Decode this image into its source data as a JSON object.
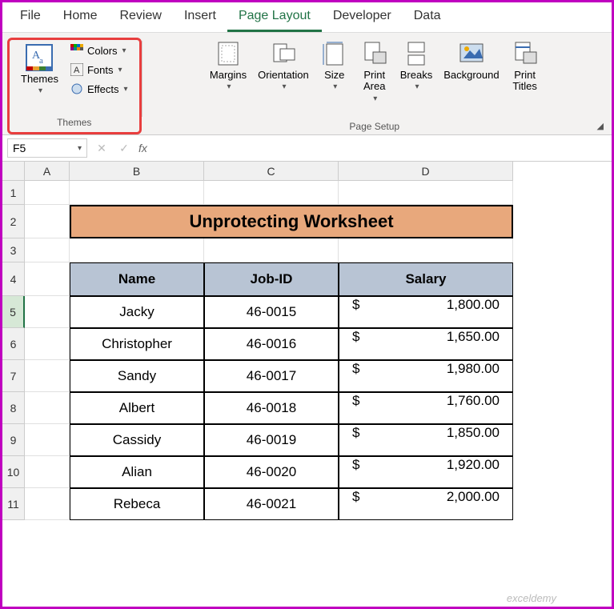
{
  "tabs": {
    "file": "File",
    "home": "Home",
    "review": "Review",
    "insert": "Insert",
    "pagelayout": "Page Layout",
    "developer": "Developer",
    "data": "Data"
  },
  "ribbon": {
    "themes": {
      "label": "Themes",
      "themes_btn": "Themes",
      "colors": "Colors",
      "fonts": "Fonts",
      "effects": "Effects"
    },
    "pagesetup": {
      "label": "Page Setup",
      "margins": "Margins",
      "orientation": "Orientation",
      "size": "Size",
      "printarea": "Print\nArea",
      "breaks": "Breaks",
      "background": "Background",
      "printtitles": "Print\nTitles"
    }
  },
  "namebox": {
    "value": "F5",
    "fx": "fx"
  },
  "cols": {
    "A": "A",
    "B": "B",
    "C": "C",
    "D": "D"
  },
  "rows": [
    "1",
    "2",
    "3",
    "4",
    "5",
    "6",
    "7",
    "8",
    "9",
    "10",
    "11"
  ],
  "sheet": {
    "title": "Unprotecting Worksheet",
    "headers": {
      "name": "Name",
      "jobid": "Job-ID",
      "salary": "Salary"
    },
    "data": [
      {
        "name": "Jacky",
        "jobid": "46-0015",
        "sal": "1,800.00"
      },
      {
        "name": "Christopher",
        "jobid": "46-0016",
        "sal": "1,650.00"
      },
      {
        "name": "Sandy",
        "jobid": "46-0017",
        "sal": "1,980.00"
      },
      {
        "name": "Albert",
        "jobid": "46-0018",
        "sal": "1,760.00"
      },
      {
        "name": "Cassidy",
        "jobid": "46-0019",
        "sal": "1,850.00"
      },
      {
        "name": "Alian",
        "jobid": "46-0020",
        "sal": "1,920.00"
      },
      {
        "name": "Rebeca",
        "jobid": "46-0021",
        "sal": "2,000.00"
      }
    ],
    "currency": "$"
  },
  "watermark": "exceldemy"
}
